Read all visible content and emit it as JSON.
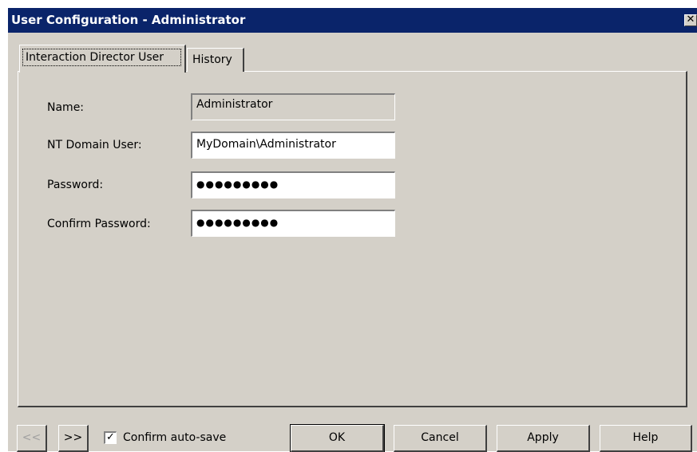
{
  "window": {
    "title": "User Configuration - Administrator",
    "close_glyph": "✕"
  },
  "tabs": [
    {
      "label": "Interaction Director User",
      "active": true
    },
    {
      "label": "History",
      "active": false
    }
  ],
  "form": {
    "name_label": "Name:",
    "name_value": "Administrator",
    "nt_user_label": "NT Domain User:",
    "nt_user_value": "MyDomain\\Administrator",
    "password_label": "Password:",
    "password_value": "●●●●●●●●●",
    "confirm_label": "Confirm Password:",
    "confirm_value": "●●●●●●●●●"
  },
  "footer": {
    "prev_label": "<<",
    "next_label": ">>",
    "autosave_label": "Confirm auto-save",
    "autosave_checked": true,
    "check_glyph": "✓",
    "ok_label": "OK",
    "cancel_label": "Cancel",
    "apply_label": "Apply",
    "help_label": "Help"
  },
  "colors": {
    "titlebar": "#0a246a",
    "dialog_face": "#d4d0c8",
    "disabled_text": "#a0a0a0"
  }
}
